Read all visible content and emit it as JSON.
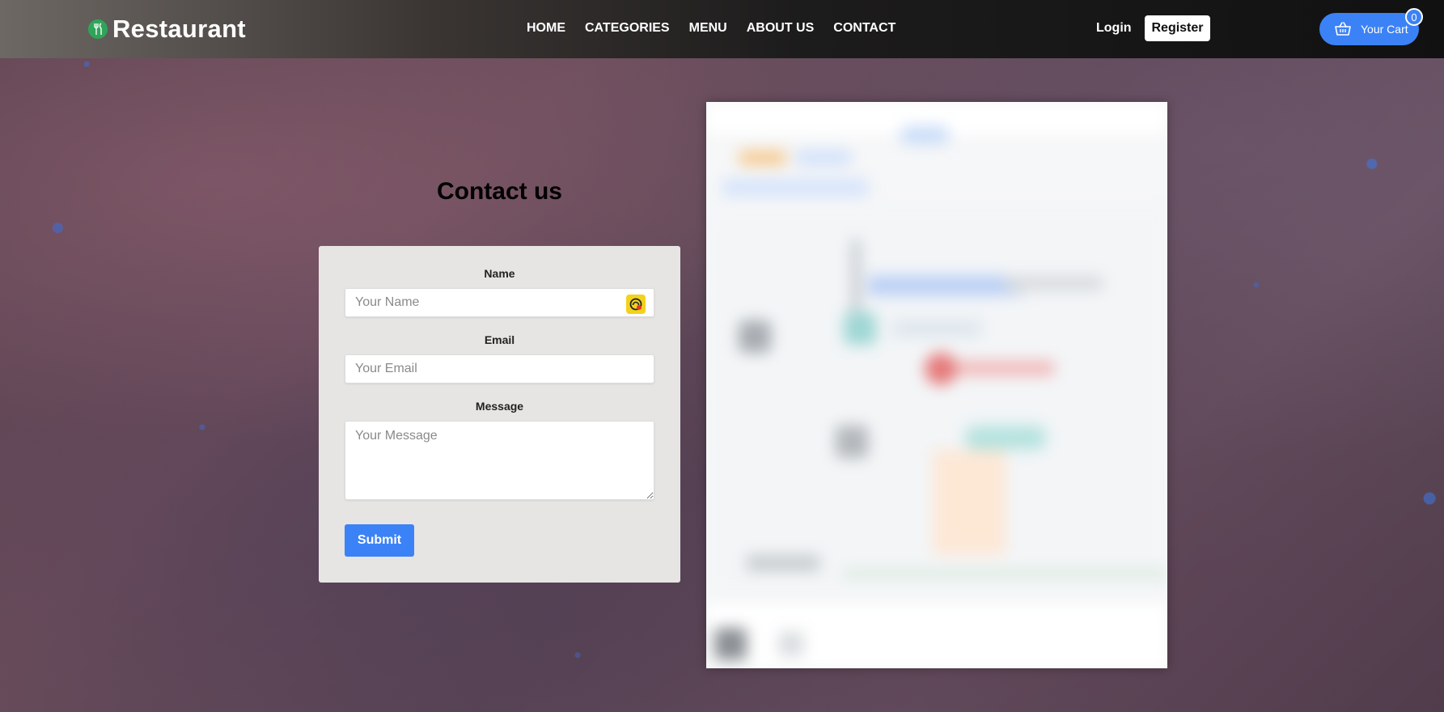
{
  "header": {
    "brand": "Restaurant",
    "nav": [
      "HOME",
      "CATEGORIES",
      "MENU",
      "ABOUT US",
      "CONTACT"
    ],
    "login_label": "Login",
    "register_label": "Register",
    "cart_label": "Your Cart",
    "cart_count": "0"
  },
  "contact": {
    "title": "Contact us",
    "name_label": "Name",
    "name_placeholder": "Your Name",
    "email_label": "Email",
    "email_placeholder": "Your Email",
    "message_label": "Message",
    "message_placeholder": "Your Message",
    "submit_label": "Submit"
  },
  "icons": {
    "brand": "fork-knife-icon",
    "cart": "basket-icon",
    "autofill": "autofill-extension-icon"
  },
  "colors": {
    "accent": "#3b82f6",
    "brand_logo": "#2fa55a",
    "form_background": "#e6e5e3"
  }
}
